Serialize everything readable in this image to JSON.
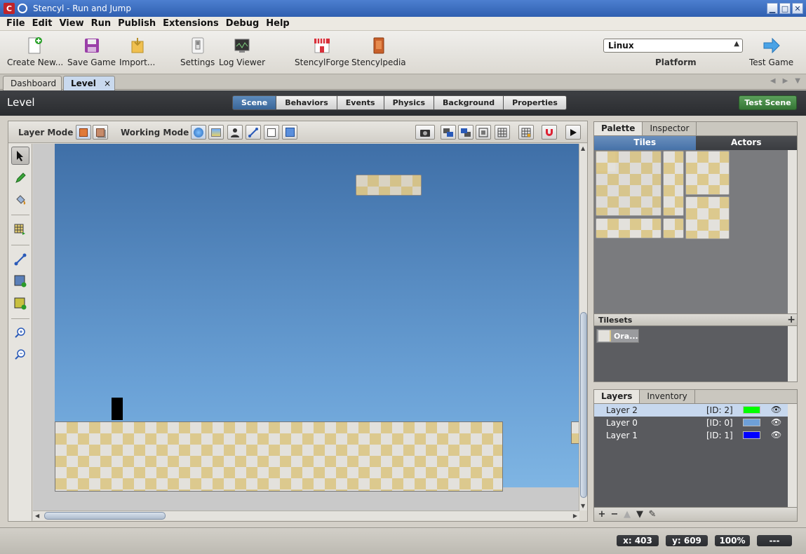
{
  "window": {
    "title": "Stencyl - Run and Jump",
    "app_badge": "C",
    "minimize_glyph": "▁",
    "maximize_glyph": "□",
    "close_glyph": "✕"
  },
  "menu": [
    "File",
    "Edit",
    "View",
    "Run",
    "Publish",
    "Extensions",
    "Debug",
    "Help"
  ],
  "toolbar": {
    "create_new": "Create New...",
    "save_game": "Save Game",
    "import": "Import...",
    "settings": "Settings",
    "log_viewer": "Log Viewer",
    "stencylforge": "StencylForge",
    "stencylpedia": "Stencylpedia",
    "platform_value": "Linux",
    "platform_label": "Platform",
    "test_game": "Test Game"
  },
  "tabs": {
    "dashboard": "Dashboard",
    "level": "Level",
    "close_glyph": "×"
  },
  "header": {
    "title": "Level",
    "scene_tabs": [
      "Scene",
      "Behaviors",
      "Events",
      "Physics",
      "Background",
      "Properties"
    ],
    "active_tab": "Scene",
    "test_scene": "Test Scene"
  },
  "scene": {
    "layer_mode_label": "Layer Mode",
    "working_mode_label": "Working Mode"
  },
  "palette": {
    "tabs": [
      "Palette",
      "Inspector"
    ],
    "active_tab": "Palette",
    "subtabs": [
      "Tiles",
      "Actors"
    ],
    "tilesets_label": "Tilesets",
    "tilesets_add": "+",
    "tileset_item": "Ora..."
  },
  "layers": {
    "tabs": [
      "Layers",
      "Inventory"
    ],
    "active_tab": "Layers",
    "rows": [
      {
        "name": "Layer 2",
        "id": "[ID: 2]",
        "color": "#00ff00",
        "selected": true
      },
      {
        "name": "Layer 0",
        "id": "[ID: 0]",
        "color": "#6ea0d8",
        "selected": false
      },
      {
        "name": "Layer 1",
        "id": "[ID: 1]",
        "color": "#0000ff",
        "selected": false
      }
    ],
    "footer": [
      "+",
      "−",
      "▲",
      "▼",
      "✎"
    ]
  },
  "status": {
    "x": "x: 403",
    "y": "y: 609",
    "zoom": "100%",
    "extra": "---"
  }
}
